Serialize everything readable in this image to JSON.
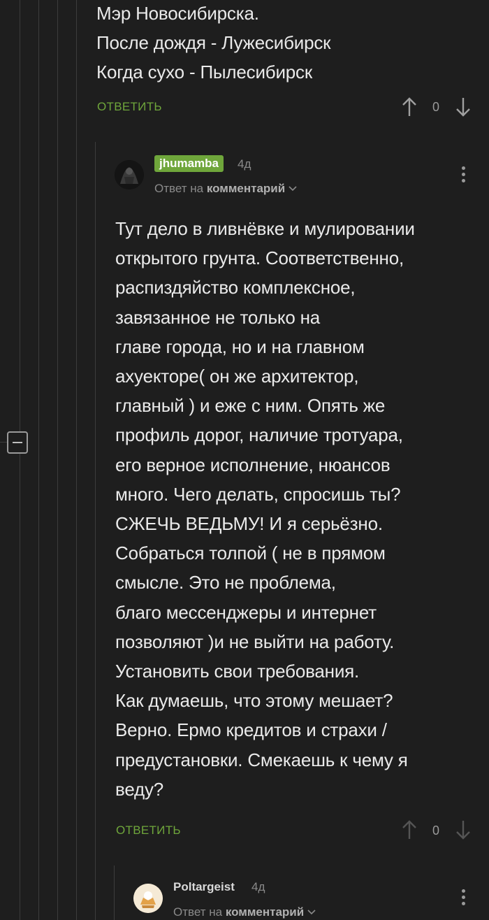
{
  "top_comment": {
    "lines": "Мэр Новосибирска.\nПосле дождя - Лужесибирск\nКогда сухо - Пылесибирск",
    "reply_label": "ОТВЕТИТЬ",
    "score": "0"
  },
  "comment_jhumamba": {
    "username": "jhumamba",
    "time": "4д",
    "reply_prefix": "Ответ на",
    "reply_target": "комментарий",
    "text": "Тут дело в ливнёвке и мулировании\nоткрытого грунта. Соответственно,\nраспиздяйство комплексное,\nзавязанное не только на\nглаве города, но и на главном\nахуекторе( он же архитектор,\nглавный ) и еже с ним. Опять же\nпрофиль дорог, наличие тротуара,\nего верное исполнение, нюансов\nмного. Чего делать, спросишь ты?\nСЖЕЧЬ ВЕДЬМУ! И я серьёзно.\nСобраться толпой ( не в прямом\nсмысле. Это не проблема,\nблаго мессенджеры и интернет\nпозволяют )и не выйти на работу.\nУстановить свои требования.\nКак думаешь, что этому мешает?\nВерно. Ермо кредитов и страхи /\nпредустановки. Смекаешь к чему я\nведу?",
    "reply_label": "ОТВЕТИТЬ",
    "score": "0"
  },
  "comment_poltargeist": {
    "username": "Poltargeist",
    "time": "4д",
    "reply_prefix": "Ответ на",
    "reply_target": "комментарий"
  },
  "colors": {
    "background": "#1e1e1e",
    "accent": "#6fa63b",
    "muted": "#8a8a8a"
  },
  "icons": [
    "upvote-icon",
    "downvote-icon",
    "more-vertical-icon",
    "chevron-down-icon",
    "collapse-thread-icon"
  ]
}
